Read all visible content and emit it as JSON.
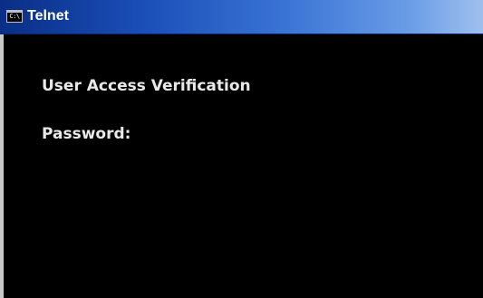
{
  "window": {
    "title": "Telnet",
    "icon": "console-icon",
    "icon_glyph": "C:\\"
  },
  "console": {
    "banner": "User Access Verification",
    "prompt": "Password:",
    "input_value": ""
  },
  "colors": {
    "console_background": "#000000",
    "console_text": "#e8e8e8",
    "titlebar_start": "#0a2e86",
    "titlebar_end": "#9fc0ee"
  }
}
